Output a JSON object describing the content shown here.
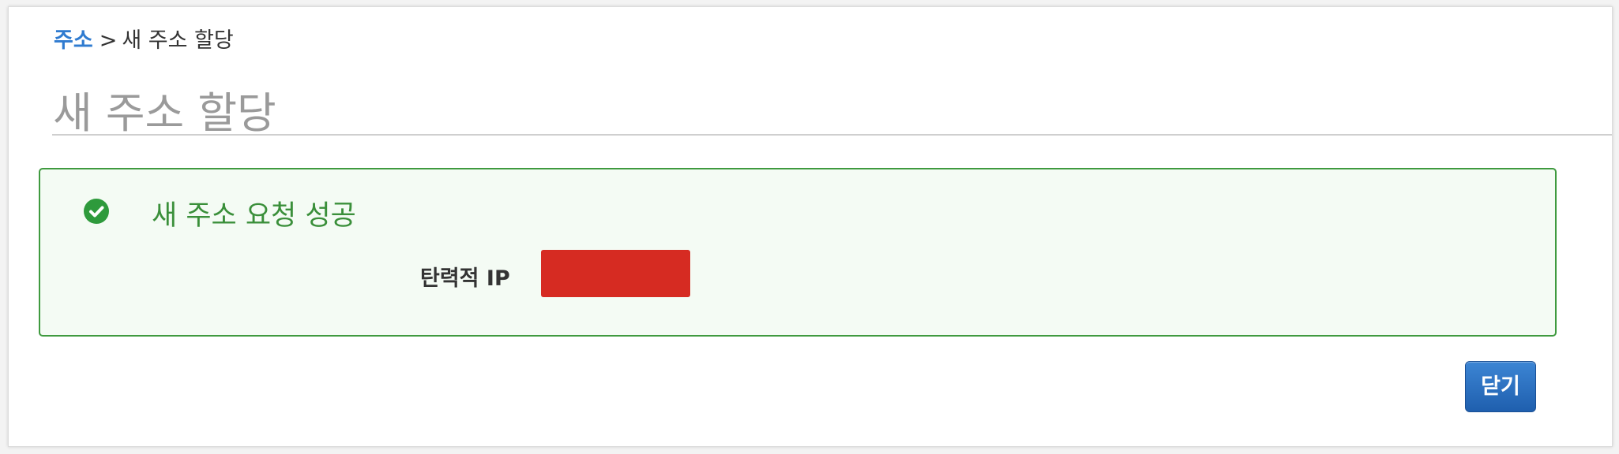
{
  "breadcrumb": {
    "parent": "주소",
    "separator": ">",
    "current": "새 주소 할당"
  },
  "page": {
    "title": "새 주소 할당"
  },
  "success": {
    "icon": "check-circle-icon",
    "message": "새 주소 요청 성공",
    "field_label": "탄력적 IP",
    "field_value": "",
    "redaction_color": "#d62b22"
  },
  "actions": {
    "close_label": "닫기"
  },
  "colors": {
    "link": "#2f7bd0",
    "success_text": "#3a8f3a",
    "success_border": "#3f9a3f",
    "success_bg": "#f4fbf4",
    "primary_button": "#2a6fc0"
  }
}
